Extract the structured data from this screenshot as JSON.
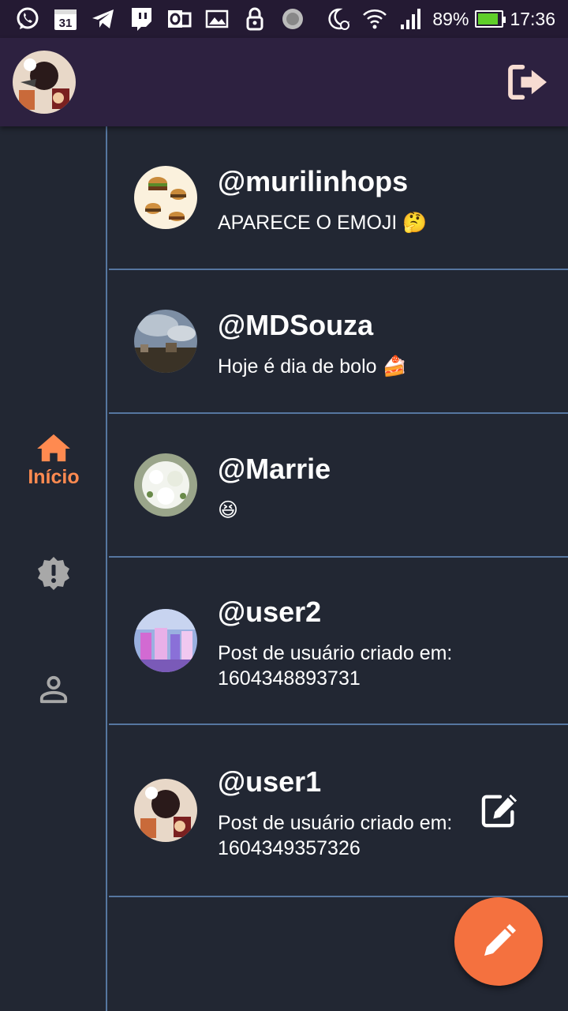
{
  "status_bar": {
    "icons": [
      "whatsapp-icon",
      "calendar-icon",
      "telegram-icon",
      "twitch-icon",
      "outlook-icon",
      "gallery-icon",
      "lock-icon",
      "loading-icon",
      "do-not-disturb-icon",
      "wifi-icon",
      "signal-icon"
    ],
    "calendar_day": "31",
    "battery_percent": "89%",
    "battery_level": 0.89,
    "time": "17:36"
  },
  "app_bar": {
    "avatar": "user-avatar",
    "logout_icon": "logout-icon"
  },
  "nav": {
    "items": [
      {
        "name": "home",
        "label": "Início",
        "icon": "home-icon",
        "active": true
      },
      {
        "name": "alerts",
        "label": "",
        "icon": "alert-badge-icon",
        "active": false
      },
      {
        "name": "profile",
        "label": "",
        "icon": "person-icon",
        "active": false
      }
    ]
  },
  "posts": [
    {
      "user": "@murilinhops",
      "text": "APARECE O EMOJI 🤔",
      "editable": false
    },
    {
      "user": "@MDSouza",
      "text": "Hoje é dia de bolo 🍰",
      "editable": false
    },
    {
      "user": "@Marrie",
      "text": "😆",
      "editable": false
    },
    {
      "user": "@user2",
      "text": "Post de usuário criado em: 1604348893731",
      "editable": false
    },
    {
      "user": "@user1",
      "text": "Post de usuário criado em: 1604349357326",
      "editable": true
    }
  ],
  "fab": {
    "icon": "pencil-icon"
  },
  "colors": {
    "accent": "#f4713f",
    "active_nav": "#ff8a50",
    "background": "#222733",
    "app_bar": "#2d2140",
    "divider": "#5676a0"
  }
}
